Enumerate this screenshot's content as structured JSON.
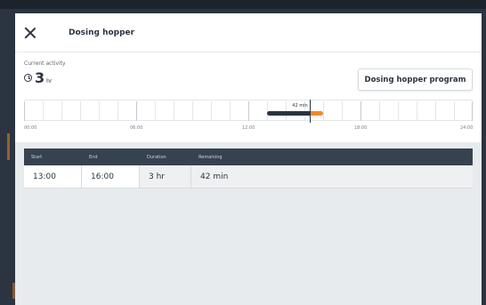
{
  "dialog": {
    "title": "Dosing hopper"
  },
  "activity": {
    "label": "Current activity",
    "value": "3",
    "unit": "hr"
  },
  "program_button": {
    "label": "Dosing hopper program"
  },
  "timeline": {
    "labels": [
      "00:00",
      "06:00",
      "12:00",
      "18:00",
      "24:00"
    ],
    "now_label": "42 min",
    "dark_bar": {
      "start_hr": 13.0,
      "end_hr": 15.3
    },
    "orange_bar": {
      "start_hr": 15.3,
      "end_hr": 16.0
    }
  },
  "table": {
    "headers": [
      "Start",
      "End",
      "Duration",
      "Remaining"
    ],
    "rows": [
      {
        "start": "13:00",
        "end": "16:00",
        "duration": "3 hr",
        "remaining": "42 min"
      }
    ]
  },
  "colors": {
    "dark": "#2b3440",
    "accent": "#f08a2a"
  }
}
